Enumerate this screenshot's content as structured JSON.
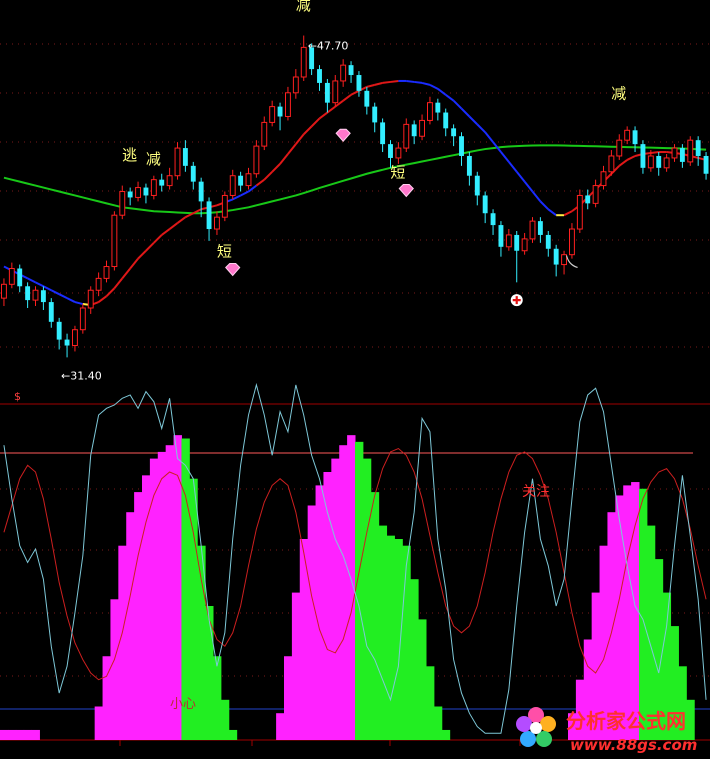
{
  "chart_data": {
    "type": "candlestick",
    "title": "",
    "price_panel": {
      "ylim": [
        30,
        49.5
      ],
      "price_high_label": "47.70",
      "price_low_label": "31.40",
      "candles": [
        [
          0,
          34.4,
          35.1,
          34.0,
          35.4
        ],
        [
          1,
          35.1,
          35.9,
          34.9,
          36.2
        ],
        [
          2,
          35.9,
          35.0,
          34.7,
          36.1
        ],
        [
          3,
          35.0,
          34.3,
          33.9,
          35.2
        ],
        [
          4,
          34.3,
          34.8,
          34.0,
          35.0
        ],
        [
          5,
          34.8,
          34.2,
          33.8,
          35.0
        ],
        [
          6,
          34.2,
          33.2,
          32.9,
          34.4
        ],
        [
          7,
          33.2,
          32.3,
          31.8,
          33.4
        ],
        [
          8,
          32.3,
          32.0,
          31.4,
          32.6
        ],
        [
          9,
          32.0,
          32.8,
          31.7,
          33.0
        ],
        [
          10,
          32.8,
          33.9,
          32.6,
          34.1
        ],
        [
          11,
          33.9,
          34.8,
          33.6,
          35.0
        ],
        [
          12,
          34.8,
          35.4,
          34.5,
          35.7
        ],
        [
          13,
          35.4,
          36.0,
          35.2,
          36.3
        ],
        [
          14,
          36.0,
          38.6,
          35.8,
          38.8
        ],
        [
          15,
          38.6,
          39.8,
          38.4,
          40.1
        ],
        [
          16,
          39.8,
          39.5,
          39.1,
          40.0
        ],
        [
          17,
          39.5,
          40.0,
          39.3,
          40.3
        ],
        [
          18,
          40.0,
          39.6,
          39.2,
          40.2
        ],
        [
          19,
          39.6,
          40.4,
          39.4,
          40.6
        ],
        [
          20,
          40.4,
          40.1,
          39.8,
          40.7
        ],
        [
          21,
          40.1,
          40.6,
          39.9,
          41.0
        ],
        [
          22,
          40.6,
          42.0,
          40.4,
          42.3
        ],
        [
          23,
          42.0,
          41.1,
          40.8,
          42.4
        ],
        [
          24,
          41.1,
          40.3,
          39.9,
          41.3
        ],
        [
          25,
          40.3,
          39.3,
          38.5,
          40.5
        ],
        [
          26,
          39.3,
          37.9,
          37.3,
          39.5
        ],
        [
          27,
          37.9,
          38.5,
          37.6,
          38.8
        ],
        [
          28,
          38.5,
          39.6,
          38.3,
          39.8
        ],
        [
          29,
          39.6,
          40.6,
          39.4,
          40.9
        ],
        [
          30,
          40.6,
          40.1,
          39.8,
          40.8
        ],
        [
          31,
          40.1,
          40.7,
          39.9,
          41.0
        ],
        [
          32,
          40.7,
          42.1,
          40.5,
          42.4
        ],
        [
          33,
          42.1,
          43.3,
          41.9,
          43.6
        ],
        [
          34,
          43.3,
          44.1,
          43.1,
          44.4
        ],
        [
          35,
          44.1,
          43.6,
          42.9,
          44.3
        ],
        [
          36,
          43.6,
          44.8,
          43.4,
          45.1
        ],
        [
          37,
          44.8,
          45.6,
          44.5,
          46.0
        ],
        [
          38,
          45.6,
          47.1,
          45.4,
          47.7
        ],
        [
          39,
          47.1,
          46.0,
          45.7,
          47.3
        ],
        [
          40,
          46.0,
          45.3,
          44.9,
          46.2
        ],
        [
          41,
          45.3,
          44.3,
          43.8,
          45.5
        ],
        [
          42,
          44.3,
          45.4,
          44.1,
          45.7
        ],
        [
          43,
          45.4,
          46.2,
          45.1,
          46.5
        ],
        [
          44,
          46.2,
          45.7,
          45.3,
          46.4
        ],
        [
          45,
          45.7,
          44.9,
          44.6,
          45.9
        ],
        [
          46,
          44.9,
          44.1,
          43.7,
          45.1
        ],
        [
          47,
          44.1,
          43.3,
          42.8,
          44.3
        ],
        [
          48,
          43.3,
          42.2,
          41.8,
          43.5
        ],
        [
          49,
          42.2,
          41.5,
          41.0,
          42.4
        ],
        [
          50,
          41.5,
          42.0,
          41.2,
          42.3
        ],
        [
          51,
          42.0,
          43.2,
          41.8,
          43.5
        ],
        [
          52,
          43.2,
          42.6,
          42.2,
          43.4
        ],
        [
          53,
          42.6,
          43.4,
          42.4,
          43.7
        ],
        [
          54,
          43.4,
          44.3,
          43.2,
          44.6
        ],
        [
          55,
          44.3,
          43.8,
          43.4,
          44.5
        ],
        [
          56,
          43.8,
          43.0,
          42.6,
          44.0
        ],
        [
          57,
          43.0,
          42.6,
          42.1,
          43.2
        ],
        [
          58,
          42.6,
          41.6,
          41.1,
          42.8
        ],
        [
          59,
          41.6,
          40.6,
          40.1,
          41.8
        ],
        [
          60,
          40.6,
          39.6,
          39.1,
          40.8
        ],
        [
          61,
          39.6,
          38.7,
          38.2,
          39.8
        ],
        [
          62,
          38.7,
          38.1,
          37.6,
          38.9
        ],
        [
          63,
          38.1,
          37.0,
          36.5,
          38.3
        ],
        [
          64,
          37.0,
          37.6,
          36.8,
          37.9
        ],
        [
          65,
          37.6,
          36.8,
          35.2,
          37.8
        ],
        [
          66,
          36.8,
          37.4,
          36.6,
          37.7
        ],
        [
          67,
          37.4,
          38.3,
          37.2,
          38.5
        ],
        [
          68,
          38.3,
          37.6,
          37.2,
          38.5
        ],
        [
          69,
          37.6,
          36.9,
          36.5,
          37.8
        ],
        [
          70,
          36.9,
          36.1,
          35.5,
          37.1
        ],
        [
          71,
          36.1,
          36.6,
          35.6,
          36.8
        ],
        [
          72,
          36.6,
          37.9,
          36.4,
          38.2
        ],
        [
          73,
          37.9,
          39.6,
          37.7,
          39.9
        ],
        [
          74,
          39.6,
          39.2,
          38.9,
          39.9
        ],
        [
          75,
          39.2,
          40.1,
          39.0,
          40.4
        ],
        [
          76,
          40.1,
          40.8,
          39.9,
          41.1
        ],
        [
          77,
          40.8,
          41.6,
          40.6,
          41.9
        ],
        [
          78,
          41.6,
          42.4,
          41.4,
          42.7
        ],
        [
          79,
          42.4,
          42.9,
          42.2,
          43.1
        ],
        [
          80,
          42.9,
          42.2,
          41.8,
          43.1
        ],
        [
          81,
          42.2,
          41.0,
          40.7,
          42.4
        ],
        [
          82,
          41.0,
          41.6,
          40.8,
          41.9
        ],
        [
          83,
          41.6,
          41.0,
          40.6,
          41.8
        ],
        [
          84,
          41.0,
          41.5,
          40.8,
          41.7
        ],
        [
          85,
          41.5,
          42.0,
          41.3,
          42.2
        ],
        [
          86,
          42.0,
          41.3,
          41.0,
          42.2
        ],
        [
          87,
          41.3,
          42.4,
          41.1,
          42.6
        ],
        [
          88,
          42.4,
          41.6,
          41.1,
          42.6
        ],
        [
          89,
          41.6,
          40.7,
          40.4,
          41.8
        ]
      ],
      "ma_long": [
        40.5,
        40.4,
        40.3,
        40.2,
        40.1,
        40.0,
        39.9,
        39.8,
        39.7,
        39.6,
        39.5,
        39.4,
        39.3,
        39.2,
        39.1,
        39.0,
        38.95,
        38.9,
        38.85,
        38.8,
        38.78,
        38.76,
        38.74,
        38.72,
        38.7,
        38.7,
        38.72,
        38.75,
        38.8,
        38.86,
        38.93,
        39.0,
        39.1,
        39.2,
        39.3,
        39.4,
        39.5,
        39.6,
        39.72,
        39.85,
        39.98,
        40.1,
        40.22,
        40.34,
        40.46,
        40.58,
        40.7,
        40.8,
        40.9,
        41.0,
        41.08,
        41.16,
        41.24,
        41.32,
        41.4,
        41.48,
        41.56,
        41.64,
        41.72,
        41.8,
        41.88,
        41.95,
        42.0,
        42.05,
        42.08,
        42.1,
        42.12,
        42.13,
        42.14,
        42.14,
        42.14,
        42.13,
        42.12,
        42.11,
        42.1,
        42.09,
        42.08,
        42.07,
        42.06,
        42.05,
        42.04,
        42.03,
        42.02,
        42.01,
        42.0,
        41.99,
        41.98,
        41.96,
        41.94,
        41.92
      ],
      "ma_mid": [
        36.0,
        35.8,
        35.6,
        35.4,
        35.2,
        35.0,
        34.8,
        34.6,
        34.4,
        34.2,
        34.1,
        34.05,
        34.2,
        34.5,
        34.9,
        35.4,
        35.9,
        36.4,
        36.8,
        37.2,
        37.6,
        37.9,
        38.2,
        38.5,
        38.7,
        38.9,
        39.0,
        39.1,
        39.25,
        39.4,
        39.6,
        39.8,
        40.1,
        40.4,
        40.8,
        41.2,
        41.7,
        42.2,
        42.7,
        43.1,
        43.5,
        43.8,
        44.1,
        44.4,
        44.7,
        44.9,
        45.1,
        45.2,
        45.3,
        45.35,
        45.4,
        45.4,
        45.35,
        45.3,
        45.2,
        45.0,
        44.7,
        44.4,
        44.0,
        43.6,
        43.2,
        42.8,
        42.3,
        41.8,
        41.3,
        40.8,
        40.3,
        39.8,
        39.3,
        38.9,
        38.6,
        38.6,
        38.8,
        39.1,
        39.5,
        39.9,
        40.3,
        40.7,
        41.1,
        41.4,
        41.6,
        41.7,
        41.75,
        41.8,
        41.8,
        41.75,
        41.7,
        41.6,
        41.5,
        41.4
      ],
      "ma_mid_colors": [
        "blue",
        "blue",
        "blue",
        "blue",
        "blue",
        "blue",
        "blue",
        "blue",
        "blue",
        "blue",
        "yellow",
        "red",
        "red",
        "red",
        "red",
        "red",
        "red",
        "red",
        "red",
        "red",
        "red",
        "red",
        "red",
        "red",
        "red",
        "red",
        "red",
        "red",
        "blue",
        "blue",
        "blue",
        "blue",
        "red",
        "red",
        "red",
        "red",
        "red",
        "red",
        "red",
        "red",
        "red",
        "red",
        "red",
        "red",
        "red",
        "red",
        "red",
        "red",
        "red",
        "red",
        "blue",
        "blue",
        "blue",
        "blue",
        "blue",
        "blue",
        "blue",
        "blue",
        "blue",
        "blue",
        "blue",
        "blue",
        "blue",
        "blue",
        "blue",
        "blue",
        "blue",
        "blue",
        "blue",
        "blue",
        "yellow",
        "red",
        "red",
        "red",
        "red",
        "red",
        "red",
        "red",
        "red",
        "red",
        "red",
        "red",
        "red",
        "red",
        "red",
        "red",
        "red",
        "red",
        "red",
        "red"
      ],
      "annotations": [
        {
          "text": "逃",
          "candle": 16,
          "price": 41.4,
          "color": "#ffff80"
        },
        {
          "text": "减",
          "candle": 19,
          "price": 41.2,
          "color": "#ffff80"
        },
        {
          "text": "减",
          "candle": 38,
          "price": 49.0,
          "color": "#ffff80"
        },
        {
          "text": "短",
          "candle": 28,
          "price": 36.5,
          "color": "#ffff80"
        },
        {
          "text": "短",
          "candle": 50,
          "price": 40.5,
          "color": "#ffff80"
        },
        {
          "text": "减",
          "candle": 78,
          "price": 44.5,
          "color": "#ffff80"
        },
        {
          "text": "乀",
          "candle": 72,
          "price": 36.0,
          "color": "#cccccc"
        }
      ],
      "diamonds": [
        [
          29,
          35.8
        ],
        [
          43,
          42.6
        ],
        [
          51,
          39.8
        ]
      ],
      "cross_marker": [
        65,
        34.3
      ]
    },
    "indicator_panel": {
      "ylim": [
        0,
        100
      ],
      "marker": "$",
      "labels": [
        "关注",
        "小心"
      ],
      "levels": [
        93,
        80,
        65,
        50,
        35,
        20,
        5
      ],
      "histogram": [
        3,
        3,
        3,
        3,
        3,
        0,
        0,
        0,
        0,
        0,
        0,
        0,
        10,
        25,
        42,
        58,
        68,
        74,
        79,
        84,
        86,
        88,
        91,
        90,
        78,
        58,
        40,
        25,
        12,
        3,
        0,
        0,
        0,
        0,
        0,
        8,
        25,
        44,
        60,
        70,
        76,
        80,
        84,
        88,
        91,
        89,
        84,
        74,
        64,
        61,
        60,
        58,
        48,
        36,
        22,
        10,
        3,
        0,
        0,
        0,
        0,
        0,
        0,
        0,
        0,
        0,
        0,
        0,
        0,
        0,
        0,
        0,
        8,
        18,
        30,
        44,
        58,
        68,
        73,
        76,
        77,
        75,
        64,
        54,
        44,
        34,
        22,
        12,
        0,
        0
      ],
      "cyan_line": [
        88,
        72,
        58,
        53,
        57,
        48,
        28,
        14,
        22,
        38,
        55,
        85,
        97,
        99,
        100,
        102,
        103,
        99,
        104,
        101,
        93,
        102,
        84,
        82,
        78,
        58,
        36,
        22,
        32,
        60,
        82,
        97,
        106,
        97,
        85,
        98,
        92,
        106,
        97,
        85,
        78,
        68,
        60,
        55,
        48,
        40,
        28,
        24,
        18,
        12,
        22,
        52,
        68,
        96,
        92,
        60,
        45,
        24,
        14,
        8,
        4,
        2,
        2,
        2,
        15,
        40,
        62,
        78,
        60,
        52,
        40,
        48,
        72,
        95,
        103,
        105,
        98,
        82,
        66,
        52,
        40,
        36,
        28,
        20,
        34,
        58,
        79,
        61,
        42,
        12
      ],
      "red_line": [
        62,
        70,
        78,
        82,
        80,
        72,
        60,
        47,
        37,
        29,
        24,
        20,
        18,
        19,
        24,
        32,
        43,
        55,
        65,
        73,
        78,
        80,
        79,
        73,
        62,
        48,
        36,
        30,
        28,
        32,
        40,
        52,
        63,
        71,
        76,
        78,
        76,
        68,
        56,
        43,
        33,
        27,
        26,
        30,
        38,
        50,
        62,
        73,
        81,
        86,
        87,
        85,
        80,
        72,
        61,
        50,
        40,
        34,
        32,
        34,
        40,
        50,
        62,
        72,
        80,
        85,
        86,
        84,
        79,
        72,
        62,
        50,
        38,
        28,
        22,
        20,
        24,
        32,
        42,
        54,
        64,
        72,
        77,
        80,
        81,
        78,
        72,
        63,
        52,
        42
      ]
    }
  },
  "watermark": {
    "name_text": "分析家公式网",
    "url_text": "www.88gs.com"
  }
}
